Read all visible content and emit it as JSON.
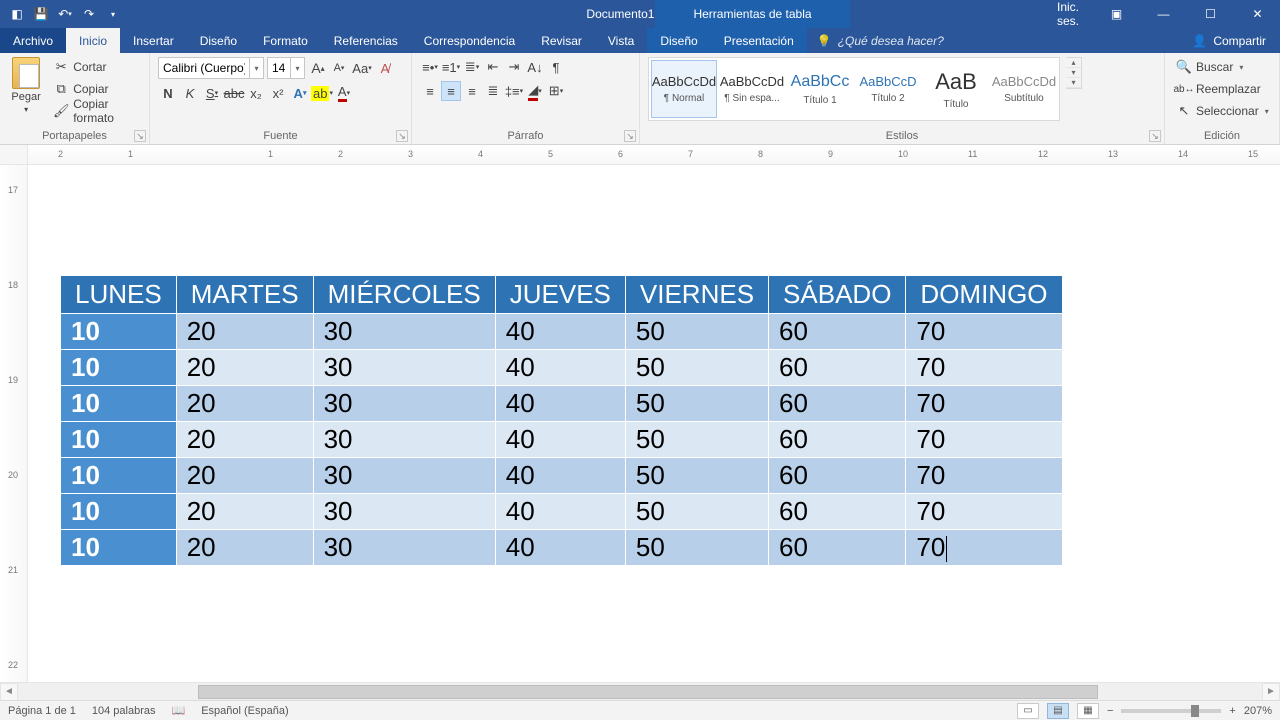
{
  "titlebar": {
    "doc_title": "Documento1 - Word",
    "context_title": "Herramientas de tabla",
    "signin": "Inic. ses."
  },
  "tabs": {
    "archivo": "Archivo",
    "inicio": "Inicio",
    "insertar": "Insertar",
    "diseno": "Diseño",
    "formato": "Formato",
    "referencias": "Referencias",
    "correspondencia": "Correspondencia",
    "revisar": "Revisar",
    "vista": "Vista",
    "ctx_diseno": "Diseño",
    "ctx_presentacion": "Presentación",
    "tellme_placeholder": "¿Qué desea hacer?",
    "compartir": "Compartir"
  },
  "ribbon": {
    "portapapeles": {
      "pegar": "Pegar",
      "cortar": "Cortar",
      "copiar": "Copiar",
      "copiar_formato": "Copiar formato",
      "label": "Portapapeles"
    },
    "fuente": {
      "font_name": "Calibri (Cuerpo)",
      "font_size": "14",
      "bold": "N",
      "italic": "K",
      "underline": "S",
      "strike": "abc",
      "sub": "x₂",
      "sup": "x²",
      "label": "Fuente"
    },
    "parrafo": {
      "label": "Párrafo"
    },
    "estilos": {
      "label": "Estilos",
      "items": [
        {
          "prev": "AaBbCcDd",
          "name": "¶ Normal"
        },
        {
          "prev": "AaBbCcDd",
          "name": "¶ Sin espa..."
        },
        {
          "prev": "AaBbCc",
          "name": "Título 1"
        },
        {
          "prev": "AaBbCcD",
          "name": "Título 2"
        },
        {
          "prev": "AaB",
          "name": "Título"
        },
        {
          "prev": "AaBbCcDd",
          "name": "Subtítulo"
        }
      ]
    },
    "edicion": {
      "buscar": "Buscar",
      "reemplazar": "Reemplazar",
      "seleccionar": "Seleccionar",
      "label": "Edición"
    }
  },
  "ruler_nums": [
    "2",
    "1",
    "",
    "1",
    "2",
    "3",
    "4",
    "5",
    "6",
    "7",
    "8",
    "9",
    "10",
    "11",
    "12",
    "13",
    "14",
    "15"
  ],
  "vruler_nums": [
    "17",
    "18",
    "19",
    "20",
    "21",
    "22"
  ],
  "table": {
    "headers": [
      "LUNES",
      "MARTES",
      "MIÉRCOLES",
      "JUEVES",
      "VIERNES",
      "SÁBADO",
      "DOMINGO"
    ],
    "rows": [
      [
        "10",
        "20",
        "30",
        "40",
        "50",
        "60",
        "70"
      ],
      [
        "10",
        "20",
        "30",
        "40",
        "50",
        "60",
        "70"
      ],
      [
        "10",
        "20",
        "30",
        "40",
        "50",
        "60",
        "70"
      ],
      [
        "10",
        "20",
        "30",
        "40",
        "50",
        "60",
        "70"
      ],
      [
        "10",
        "20",
        "30",
        "40",
        "50",
        "60",
        "70"
      ],
      [
        "10",
        "20",
        "30",
        "40",
        "50",
        "60",
        "70"
      ],
      [
        "10",
        "20",
        "30",
        "40",
        "50",
        "60",
        "70"
      ]
    ]
  },
  "status": {
    "page": "Página 1 de 1",
    "words": "104 palabras",
    "lang": "Español (España)",
    "zoom": "207%"
  }
}
